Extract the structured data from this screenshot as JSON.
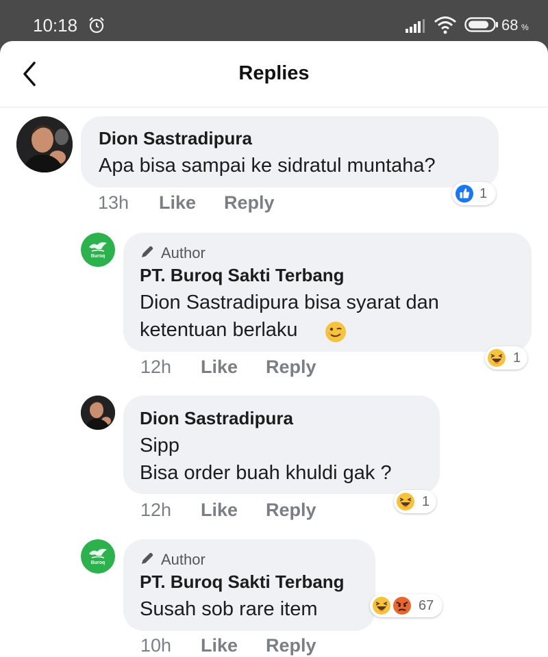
{
  "status_bar": {
    "time": "10:18",
    "battery": "68"
  },
  "header": {
    "title": "Replies"
  },
  "comments": [
    {
      "author": "Dion Sastradipura",
      "lines": [
        "Apa bisa sampai ke sidratul muntaha?"
      ],
      "time": "13h",
      "like": "Like",
      "reply": "Reply",
      "reaction_count": "1",
      "reactions": [
        "like"
      ]
    },
    {
      "author_badge": "Author",
      "author": "PT. Buroq Sakti Terbang",
      "lines": [
        "Dion Sastradipura bisa syarat dan",
        "ketentuan berlaku"
      ],
      "time": "12h",
      "like": "Like",
      "reply": "Reply",
      "reaction_count": "1",
      "reactions": [
        "haha"
      ]
    },
    {
      "author": "Dion Sastradipura",
      "lines": [
        "Sipp",
        "Bisa order buah khuldi gak ?"
      ],
      "time": "12h",
      "like": "Like",
      "reply": "Reply",
      "reaction_count": "1",
      "reactions": [
        "haha"
      ]
    },
    {
      "author_badge": "Author",
      "author": "PT. Buroq Sakti Terbang",
      "lines": [
        "Susah sob rare item"
      ],
      "time": "10h",
      "like": "Like",
      "reply": "Reply",
      "reaction_count": "67",
      "reactions": [
        "haha",
        "angry"
      ]
    }
  ],
  "avatar_brand": {
    "logo_text": "Buroq",
    "color": "#2bb24c"
  },
  "colors": {
    "like_blue": "#1877f2",
    "haha_yellow": "#f7c33d",
    "angry_orange": "#e8662f"
  }
}
